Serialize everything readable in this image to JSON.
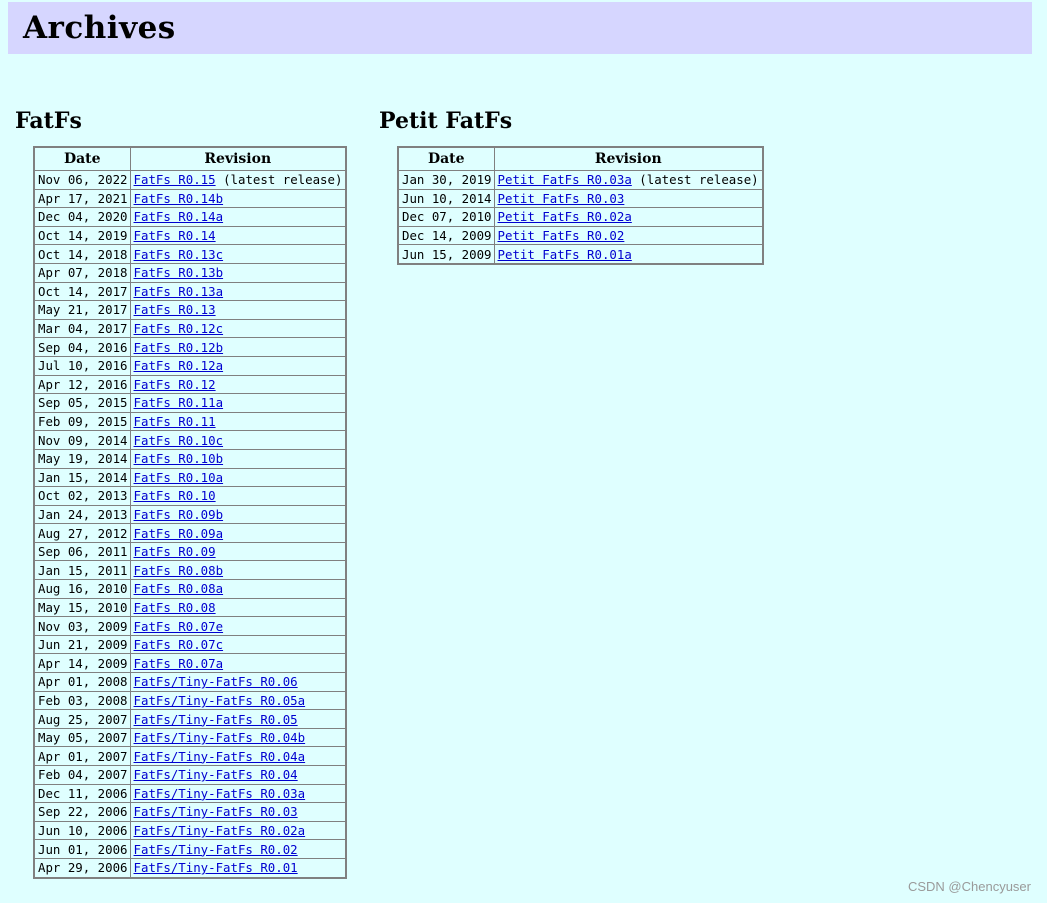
{
  "page": {
    "title": "Archives"
  },
  "sections": {
    "fatfs": {
      "heading": "FatFs",
      "columns": [
        "Date",
        "Revision"
      ],
      "rows": [
        {
          "date": "Nov 06, 2022",
          "revision": "FatFs R0.15",
          "note": "(latest release)"
        },
        {
          "date": "Apr 17, 2021",
          "revision": "FatFs R0.14b"
        },
        {
          "date": "Dec 04, 2020",
          "revision": "FatFs R0.14a"
        },
        {
          "date": "Oct 14, 2019",
          "revision": "FatFs R0.14"
        },
        {
          "date": "Oct 14, 2018",
          "revision": "FatFs R0.13c"
        },
        {
          "date": "Apr 07, 2018",
          "revision": "FatFs R0.13b"
        },
        {
          "date": "Oct 14, 2017",
          "revision": "FatFs R0.13a"
        },
        {
          "date": "May 21, 2017",
          "revision": "FatFs R0.13"
        },
        {
          "date": "Mar 04, 2017",
          "revision": "FatFs R0.12c"
        },
        {
          "date": "Sep 04, 2016",
          "revision": "FatFs R0.12b"
        },
        {
          "date": "Jul 10, 2016",
          "revision": "FatFs R0.12a"
        },
        {
          "date": "Apr 12, 2016",
          "revision": "FatFs R0.12"
        },
        {
          "date": "Sep 05, 2015",
          "revision": "FatFs R0.11a"
        },
        {
          "date": "Feb 09, 2015",
          "revision": "FatFs R0.11"
        },
        {
          "date": "Nov 09, 2014",
          "revision": "FatFs R0.10c"
        },
        {
          "date": "May 19, 2014",
          "revision": "FatFs R0.10b"
        },
        {
          "date": "Jan 15, 2014",
          "revision": "FatFs R0.10a"
        },
        {
          "date": "Oct 02, 2013",
          "revision": "FatFs R0.10"
        },
        {
          "date": "Jan 24, 2013",
          "revision": "FatFs R0.09b"
        },
        {
          "date": "Aug 27, 2012",
          "revision": "FatFs R0.09a"
        },
        {
          "date": "Sep 06, 2011",
          "revision": "FatFs R0.09"
        },
        {
          "date": "Jan 15, 2011",
          "revision": "FatFs R0.08b"
        },
        {
          "date": "Aug 16, 2010",
          "revision": "FatFs R0.08a"
        },
        {
          "date": "May 15, 2010",
          "revision": "FatFs R0.08"
        },
        {
          "date": "Nov 03, 2009",
          "revision": "FatFs R0.07e"
        },
        {
          "date": "Jun 21, 2009",
          "revision": "FatFs R0.07c"
        },
        {
          "date": "Apr 14, 2009",
          "revision": "FatFs R0.07a"
        },
        {
          "date": "Apr 01, 2008",
          "revision": "FatFs/Tiny-FatFs R0.06"
        },
        {
          "date": "Feb 03, 2008",
          "revision": "FatFs/Tiny-FatFs R0.05a"
        },
        {
          "date": "Aug 25, 2007",
          "revision": "FatFs/Tiny-FatFs R0.05"
        },
        {
          "date": "May 05, 2007",
          "revision": "FatFs/Tiny-FatFs R0.04b"
        },
        {
          "date": "Apr 01, 2007",
          "revision": "FatFs/Tiny-FatFs R0.04a"
        },
        {
          "date": "Feb 04, 2007",
          "revision": "FatFs/Tiny-FatFs R0.04"
        },
        {
          "date": "Dec 11, 2006",
          "revision": "FatFs/Tiny-FatFs R0.03a"
        },
        {
          "date": "Sep 22, 2006",
          "revision": "FatFs/Tiny-FatFs R0.03"
        },
        {
          "date": "Jun 10, 2006",
          "revision": "FatFs/Tiny-FatFs R0.02a"
        },
        {
          "date": "Jun 01, 2006",
          "revision": "FatFs/Tiny-FatFs R0.02"
        },
        {
          "date": "Apr 29, 2006",
          "revision": "FatFs/Tiny-FatFs R0.01"
        }
      ]
    },
    "petit": {
      "heading": "Petit FatFs",
      "columns": [
        "Date",
        "Revision"
      ],
      "rows": [
        {
          "date": "Jan 30, 2019",
          "revision": "Petit FatFs R0.03a",
          "note": "(latest release)"
        },
        {
          "date": "Jun 10, 2014",
          "revision": "Petit FatFs R0.03"
        },
        {
          "date": "Dec 07, 2010",
          "revision": "Petit FatFs R0.02a"
        },
        {
          "date": "Dec 14, 2009",
          "revision": "Petit FatFs R0.02"
        },
        {
          "date": "Jun 15, 2009",
          "revision": "Petit FatFs R0.01a"
        }
      ]
    }
  },
  "watermark": "CSDN @Chencyuser",
  "colors": {
    "background": "#dfffff",
    "title_bar": "#d6d6ff",
    "link": "#0000d0"
  }
}
